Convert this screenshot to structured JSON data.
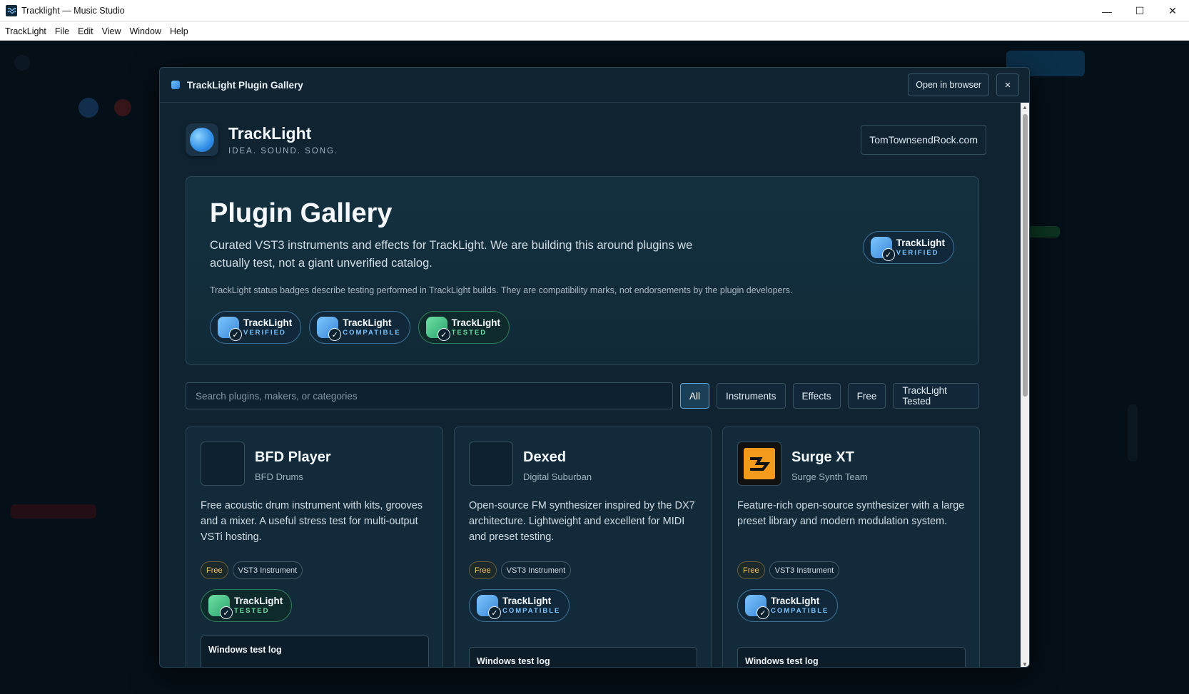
{
  "window": {
    "title": "Tracklight — Music Studio",
    "controls": {
      "minimize": "—",
      "maximize": "☐",
      "close": "✕"
    }
  },
  "menu": [
    "TrackLight",
    "File",
    "Edit",
    "View",
    "Window",
    "Help"
  ],
  "modal": {
    "title": "TrackLight Plugin Gallery",
    "open_browser": "Open in browser",
    "close": "×"
  },
  "brand": {
    "name": "TrackLight",
    "tagline": "IDEA. SOUND. SONG.",
    "site_link": "TomTownsendRock.com"
  },
  "hero": {
    "title": "Plugin Gallery",
    "description": "Curated VST3 instruments and effects for TrackLight. We are building this around plugins we actually test, not a giant unverified catalog.",
    "note": "TrackLight status badges describe testing performed in TrackLight builds. They are compatibility marks, not endorsements by the plugin developers.",
    "featured_badge": {
      "name": "TrackLight",
      "level": "VERIFIED"
    },
    "badges": [
      {
        "name": "TrackLight",
        "level": "VERIFIED",
        "color": "#7cc4ff"
      },
      {
        "name": "TrackLight",
        "level": "COMPATIBLE",
        "color": "#7cc4ff"
      },
      {
        "name": "TrackLight",
        "level": "TESTED",
        "color": "#6fe0a5"
      }
    ]
  },
  "filters": {
    "search_placeholder": "Search plugins, makers, or categories",
    "search_value": "",
    "chips": [
      "All",
      "Instruments",
      "Effects",
      "Free",
      "TrackLight Tested"
    ],
    "active": "All"
  },
  "plugins": [
    {
      "name": "BFD Player",
      "maker": "BFD Drums",
      "description": "Free acoustic drum instrument with kits, grooves and a mixer. A useful stress test for multi-output VSTi hosting.",
      "tags": [
        "Free",
        "VST3 Instrument"
      ],
      "badge": {
        "name": "TrackLight",
        "level": "TESTED"
      },
      "log_title": "Windows test log"
    },
    {
      "name": "Dexed",
      "maker": "Digital Suburban",
      "description": "Open-source FM synthesizer inspired by the DX7 architecture. Lightweight and excellent for MIDI and preset testing.",
      "tags": [
        "Free",
        "VST3 Instrument"
      ],
      "badge": {
        "name": "TrackLight",
        "level": "COMPATIBLE"
      },
      "log_title": "Windows test log"
    },
    {
      "name": "Surge XT",
      "maker": "Surge Synth Team",
      "description": "Feature-rich open-source synthesizer with a large preset library and modern modulation system.",
      "tags": [
        "Free",
        "VST3 Instrument"
      ],
      "badge": {
        "name": "TrackLight",
        "level": "COMPATIBLE"
      },
      "log_title": "Windows test log"
    }
  ],
  "colors": {
    "accent_blue": "#7cc4ff",
    "accent_green": "#6fe0a5",
    "free_tag": "#f2c170",
    "surface": "#0f2331"
  }
}
